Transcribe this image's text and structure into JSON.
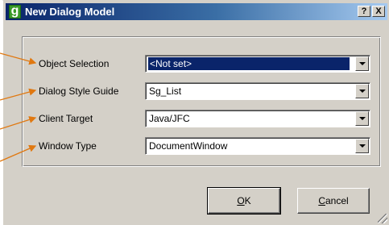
{
  "window": {
    "title": "New Dialog Model",
    "icon_glyph": "g",
    "help_label": "?",
    "close_label": "X"
  },
  "fields": [
    {
      "label": "Object Selection",
      "value": "<Not set>"
    },
    {
      "label": "Dialog Style Guide",
      "value": "Sg_List"
    },
    {
      "label": "Client Target",
      "value": "Java/JFC"
    },
    {
      "label": "Window Type",
      "value": "DocumentWindow"
    }
  ],
  "buttons": {
    "ok_mnemonic": "O",
    "ok_rest": "K",
    "cancel_mnemonic": "C",
    "cancel_rest": "ancel"
  },
  "colors": {
    "titlebar_start": "#0a246a",
    "titlebar_end": "#a6caf0",
    "dialog_face": "#d4d0c8",
    "selection": "#0a246a",
    "callout_arrow": "#ff8c1a"
  },
  "icons": {
    "app": "app-logo-icon",
    "dropdown": "chevron-down-icon",
    "resize": "resize-grip-icon"
  }
}
